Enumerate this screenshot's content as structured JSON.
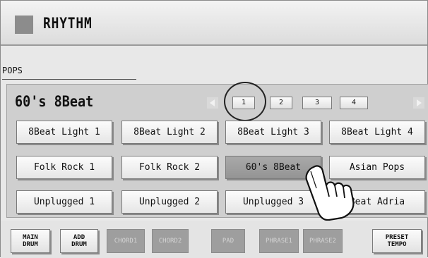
{
  "header": {
    "title": "RHYTHM"
  },
  "category": "POPS",
  "selected_rhythm": "60's 8Beat",
  "pages": [
    "1",
    "2",
    "3",
    "4"
  ],
  "styles": [
    [
      "8Beat Light 1",
      "8Beat Light 2",
      "8Beat Light 3",
      "8Beat Light 4"
    ],
    [
      "Folk Rock 1",
      "Folk Rock 2",
      "60's 8Beat",
      "Asian Pops"
    ],
    [
      "Unplugged 1",
      "Unplugged 2",
      "Unplugged 3",
      "Beat Adria"
    ]
  ],
  "bottom_buttons": {
    "main_drum": "MAIN\nDRUM",
    "add_drum": "ADD\nDRUM",
    "chord1": "CHORD1",
    "chord2": "CHORD2",
    "pad": "PAD",
    "phrase1": "PHRASE1",
    "phrase2": "PHRASE2",
    "preset_tempo": "PRESET\nTEMPO"
  }
}
